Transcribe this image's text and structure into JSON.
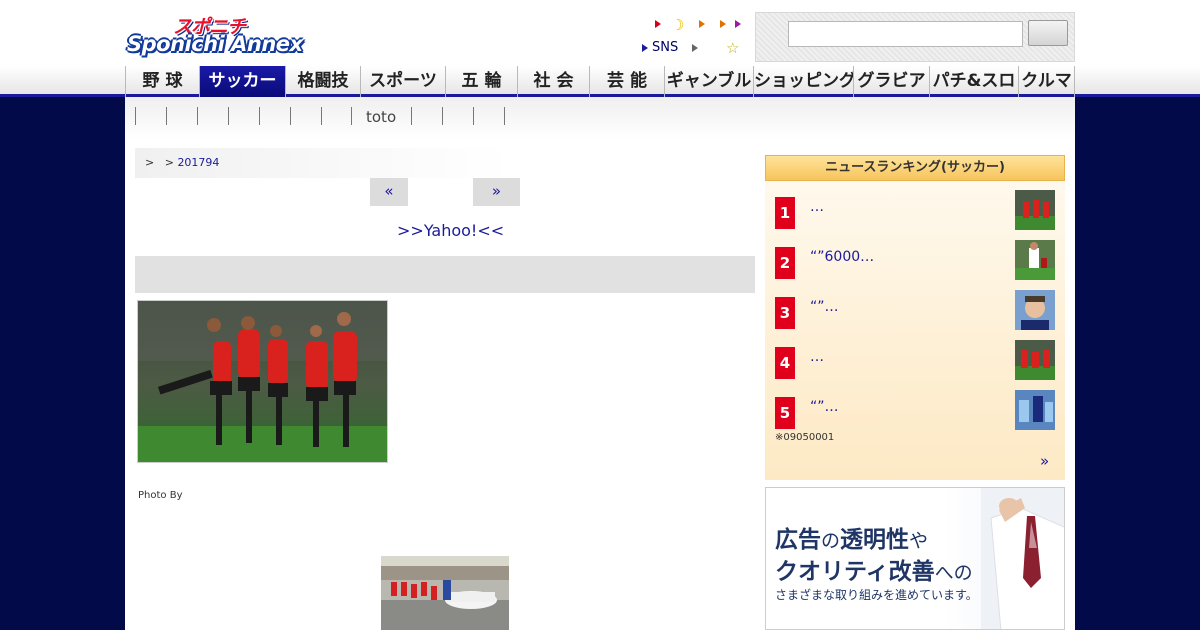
{
  "logo": {
    "line1": "スポニチ",
    "line2": "Sponichi Annex"
  },
  "toplinks": {
    "sns_label": "SNS"
  },
  "colors": {
    "navy": "#030a4a",
    "accent_blue": "#1a1a9c",
    "rank_red": "#e0001b",
    "nav_active": "#1a1aa8"
  },
  "search": {
    "placeholder": "",
    "button_label": ""
  },
  "nav": {
    "items": [
      {
        "label": "野 球"
      },
      {
        "label": "サッカー",
        "active": true
      },
      {
        "label": "格闘技"
      },
      {
        "label": "スポーツ"
      },
      {
        "label": "五 輪"
      },
      {
        "label": "社 会"
      },
      {
        "label": "芸 能"
      },
      {
        "label": "ギャンブル"
      },
      {
        "label": "ショッピング"
      },
      {
        "label": "グラビア"
      },
      {
        "label": "パチ&スロ"
      },
      {
        "label": "クルマ"
      }
    ]
  },
  "subnav": {
    "toto_label": "toto"
  },
  "breadcrumb": {
    "sep1": ">",
    "sep2": ">",
    "current": "201794"
  },
  "pager": {
    "prev_label": "«",
    "next_label": "»"
  },
  "article": {
    "yahoo_link": ">>Yahoo!<<",
    "photo_credit": "Photo By"
  },
  "ranking": {
    "title": "ニュースランキング(サッカー)",
    "items": [
      {
        "rank": "1",
        "title": "…"
      },
      {
        "rank": "2",
        "title": "“”6000…"
      },
      {
        "rank": "3",
        "title": "“”…"
      },
      {
        "rank": "4",
        "title": "…"
      },
      {
        "rank": "5",
        "title": "“”…"
      }
    ],
    "note": "※09050001",
    "more_label": "»"
  },
  "ad": {
    "line1_a": "広告",
    "line1_b": "の",
    "line1_c": "透明性",
    "line1_d": "や",
    "line2_a": "クオリティ改善",
    "line2_b": "への",
    "line3": "さまざまな取り組みを進めています。"
  }
}
